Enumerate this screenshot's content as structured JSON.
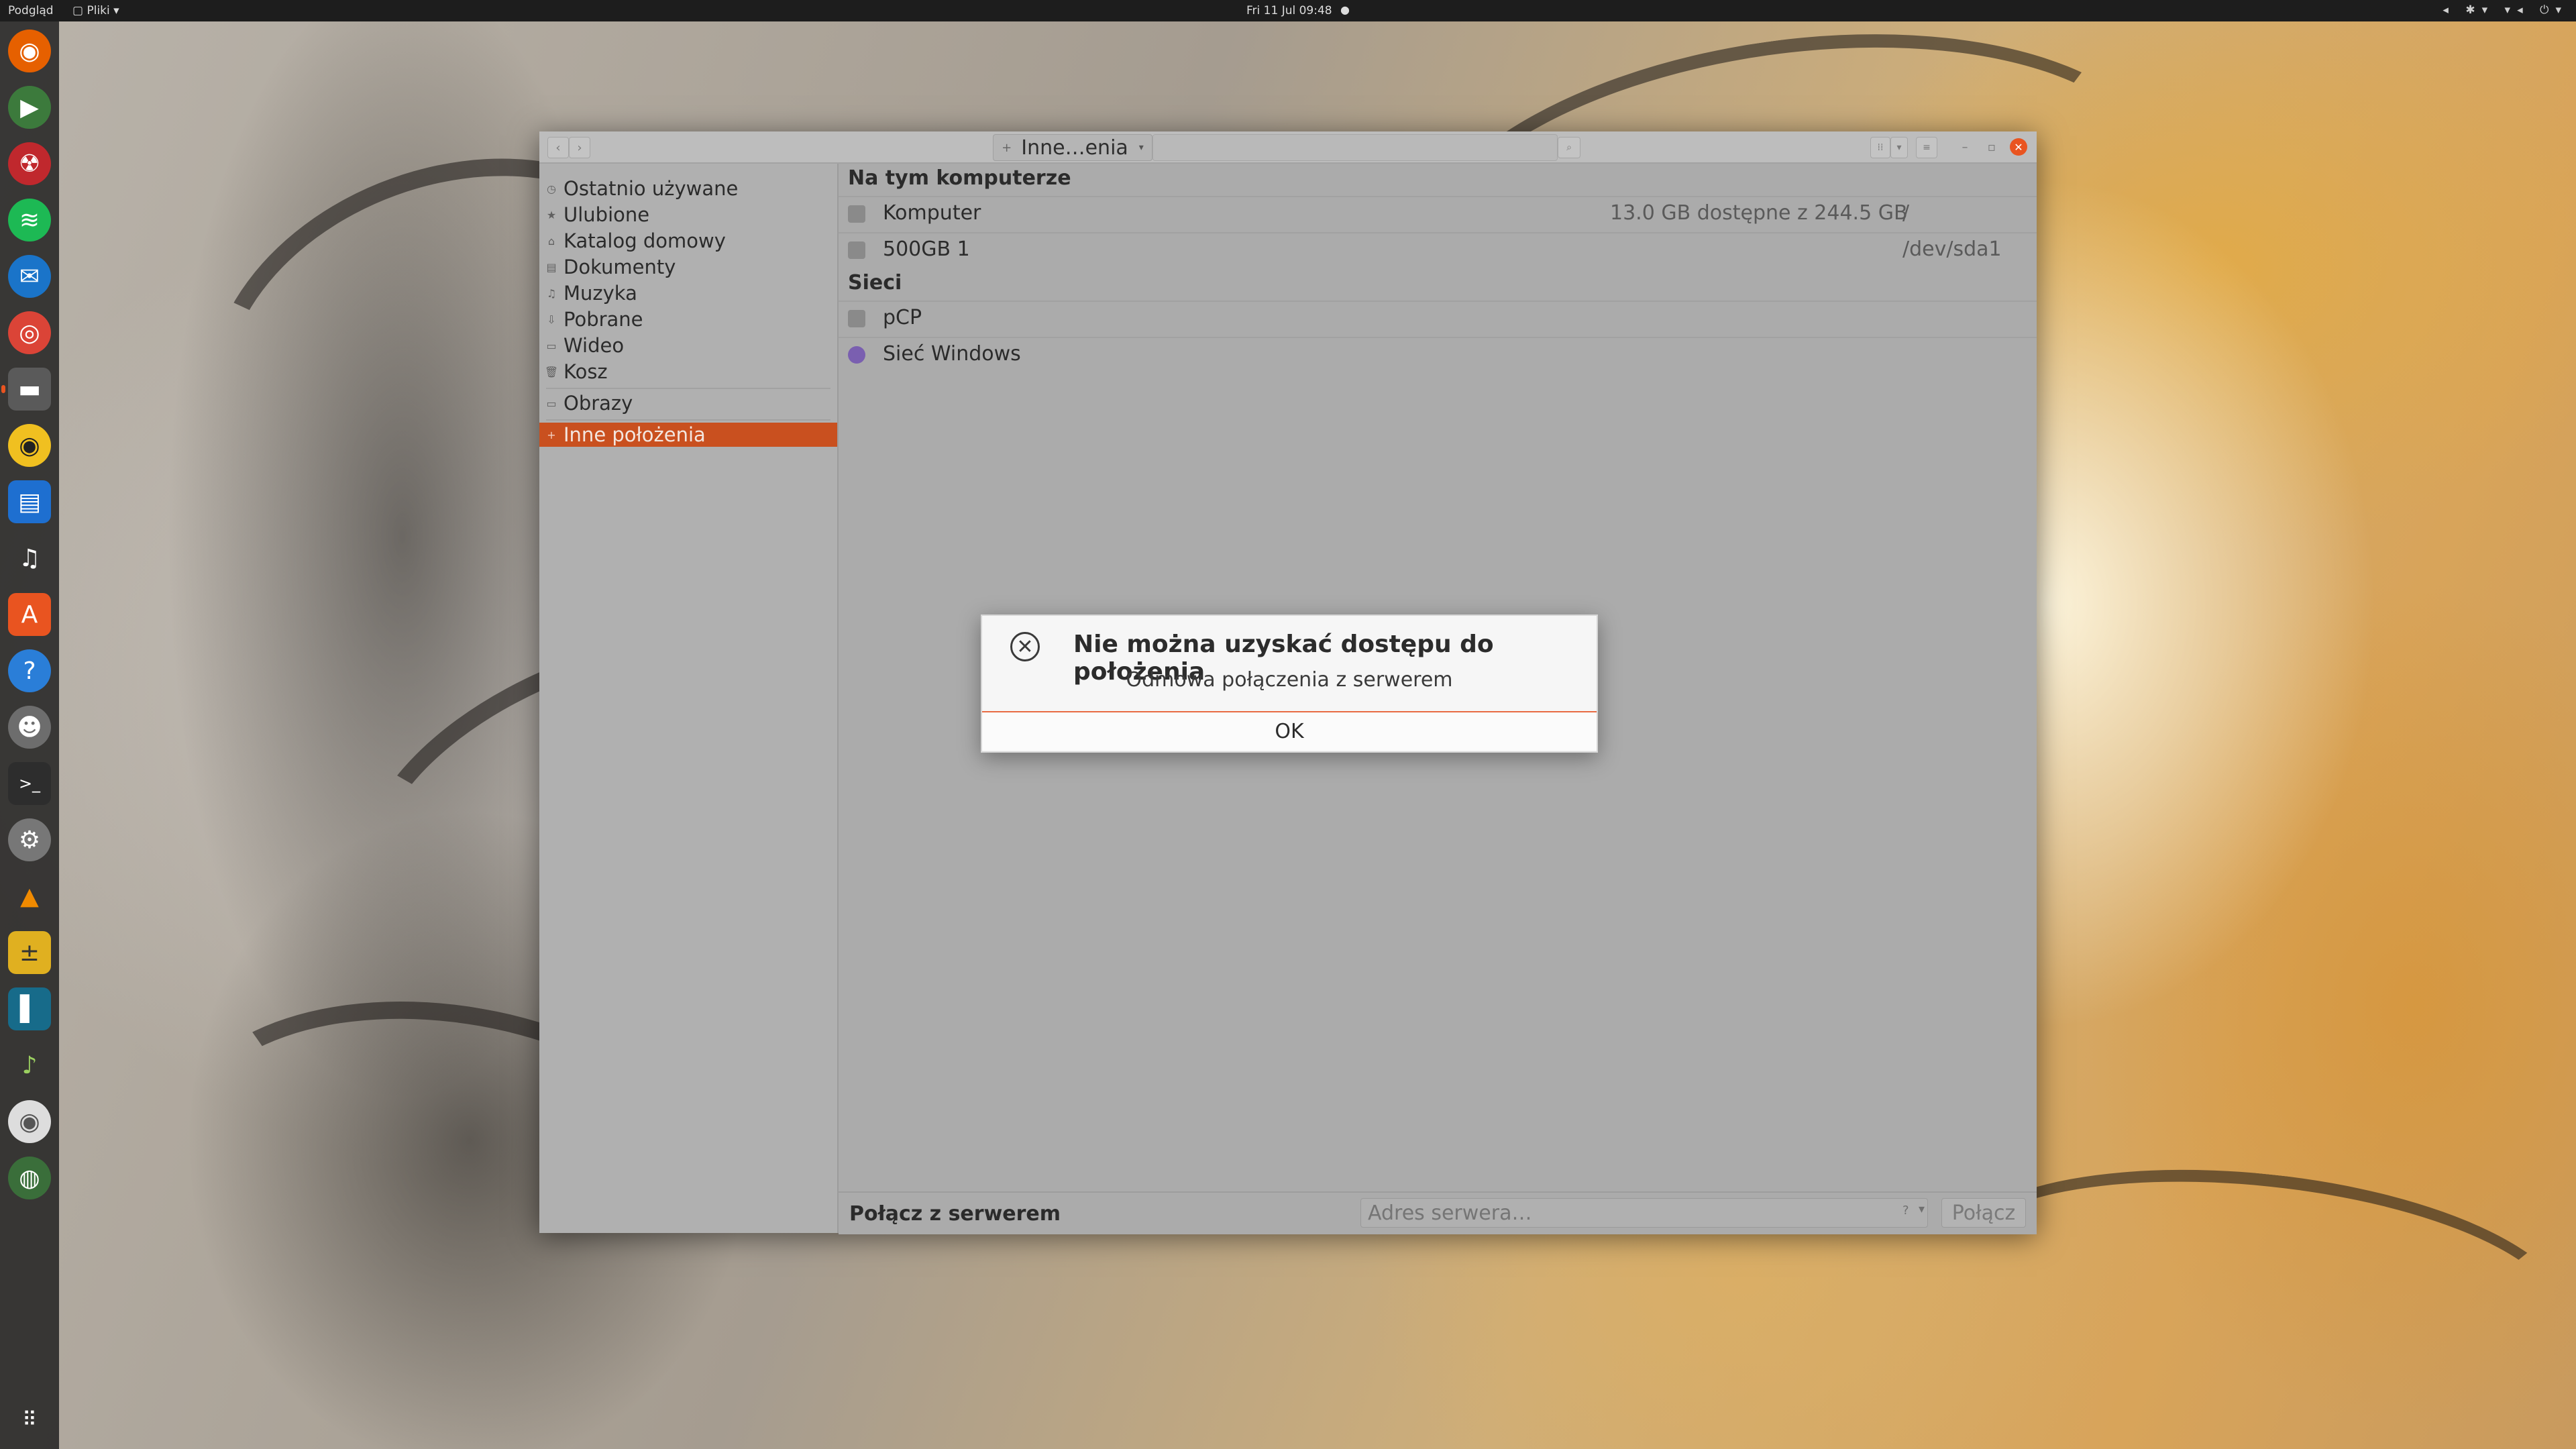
{
  "topbar": {
    "app_menu": "Podgląd",
    "files_menu": "▢ Pliki ▾",
    "clock": "Fri 11 Jul  09:48",
    "clock_dot": "●",
    "indicators": "◂ ✱▾ ▾◂ ⏻▾"
  },
  "window": {
    "path_label": "Inne…enia",
    "path_icon": "+",
    "sidebar": {
      "items": [
        {
          "icon": "◷",
          "label": "Ostatnio używane"
        },
        {
          "icon": "★",
          "label": "Ulubione"
        },
        {
          "icon": "⌂",
          "label": "Katalog domowy"
        },
        {
          "icon": "▤",
          "label": "Dokumenty"
        },
        {
          "icon": "♫",
          "label": "Muzyka"
        },
        {
          "icon": "⇩",
          "label": "Pobrane"
        },
        {
          "icon": "▭",
          "label": "Wideo"
        },
        {
          "icon": "🗑",
          "label": "Kosz"
        },
        {
          "icon": "▭",
          "label": "Obrazy"
        },
        {
          "icon": "+",
          "label": "Inne położenia"
        }
      ]
    },
    "content": {
      "section_computer": "Na tym komputerze",
      "drives": [
        {
          "name": "Komputer",
          "info": "13.0 GB dostępne z 244.5 GB",
          "mount": "/"
        },
        {
          "name": "500GB 1",
          "info": "",
          "mount": "/dev/sda1"
        }
      ],
      "section_networks": "Sieci",
      "networks": [
        {
          "name": "pCP"
        },
        {
          "name": "Sieć Windows"
        }
      ]
    },
    "connect": {
      "label": "Połącz z serwerem",
      "placeholder": "Adres serwera…",
      "button": "Połącz"
    }
  },
  "dialog": {
    "title": "Nie można uzyskać dostępu do położenia",
    "message": "Odmowa połączenia z serwerem",
    "ok_label": "OK"
  },
  "colors": {
    "accent": "#e95420",
    "selection": "#c9501f"
  }
}
